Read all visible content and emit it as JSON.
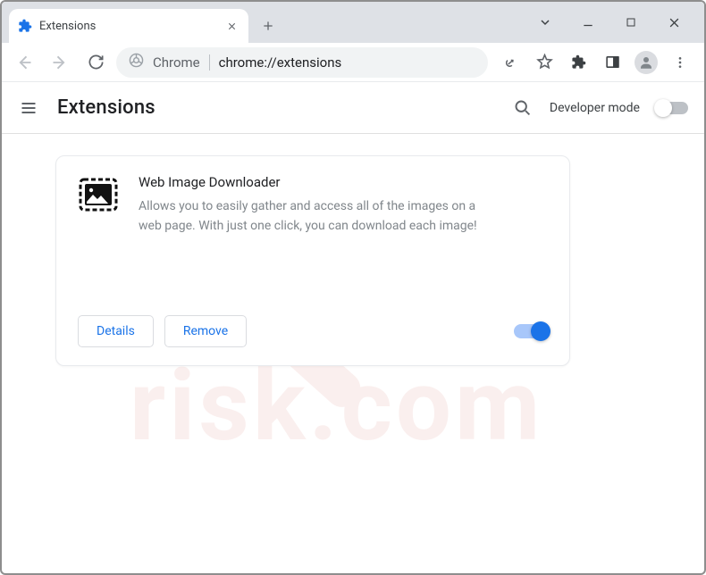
{
  "window": {
    "tab_title": "Extensions"
  },
  "omnibox": {
    "prefix": "Chrome",
    "url": "chrome://extensions"
  },
  "header": {
    "title": "Extensions",
    "dev_mode_label": "Developer mode",
    "dev_mode_on": false
  },
  "card": {
    "name": "Web Image Downloader",
    "description": "Allows you to easily gather and access all of the images on a web page. With just one click, you can download each image!",
    "details_label": "Details",
    "remove_label": "Remove",
    "enabled": true
  },
  "icons": {
    "puzzle": "puzzle-icon",
    "close": "close-icon",
    "plus": "plus-icon",
    "chevron": "chevron-down-icon",
    "minimize": "minimize-icon",
    "maximize": "maximize-icon",
    "x": "x-icon",
    "back": "back-icon",
    "forward": "forward-icon",
    "reload": "reload-icon",
    "chrome": "chrome-icon",
    "share": "share-icon",
    "star": "star-icon",
    "ext": "puzzle-icon",
    "panel": "panel-icon",
    "avatar": "avatar-icon",
    "menu": "kebab-icon",
    "hamburger": "hamburger-icon",
    "search": "search-icon",
    "image": "image-icon"
  },
  "colors": {
    "accent": "#1a73e8",
    "text": "#202124",
    "muted": "#80868b"
  }
}
